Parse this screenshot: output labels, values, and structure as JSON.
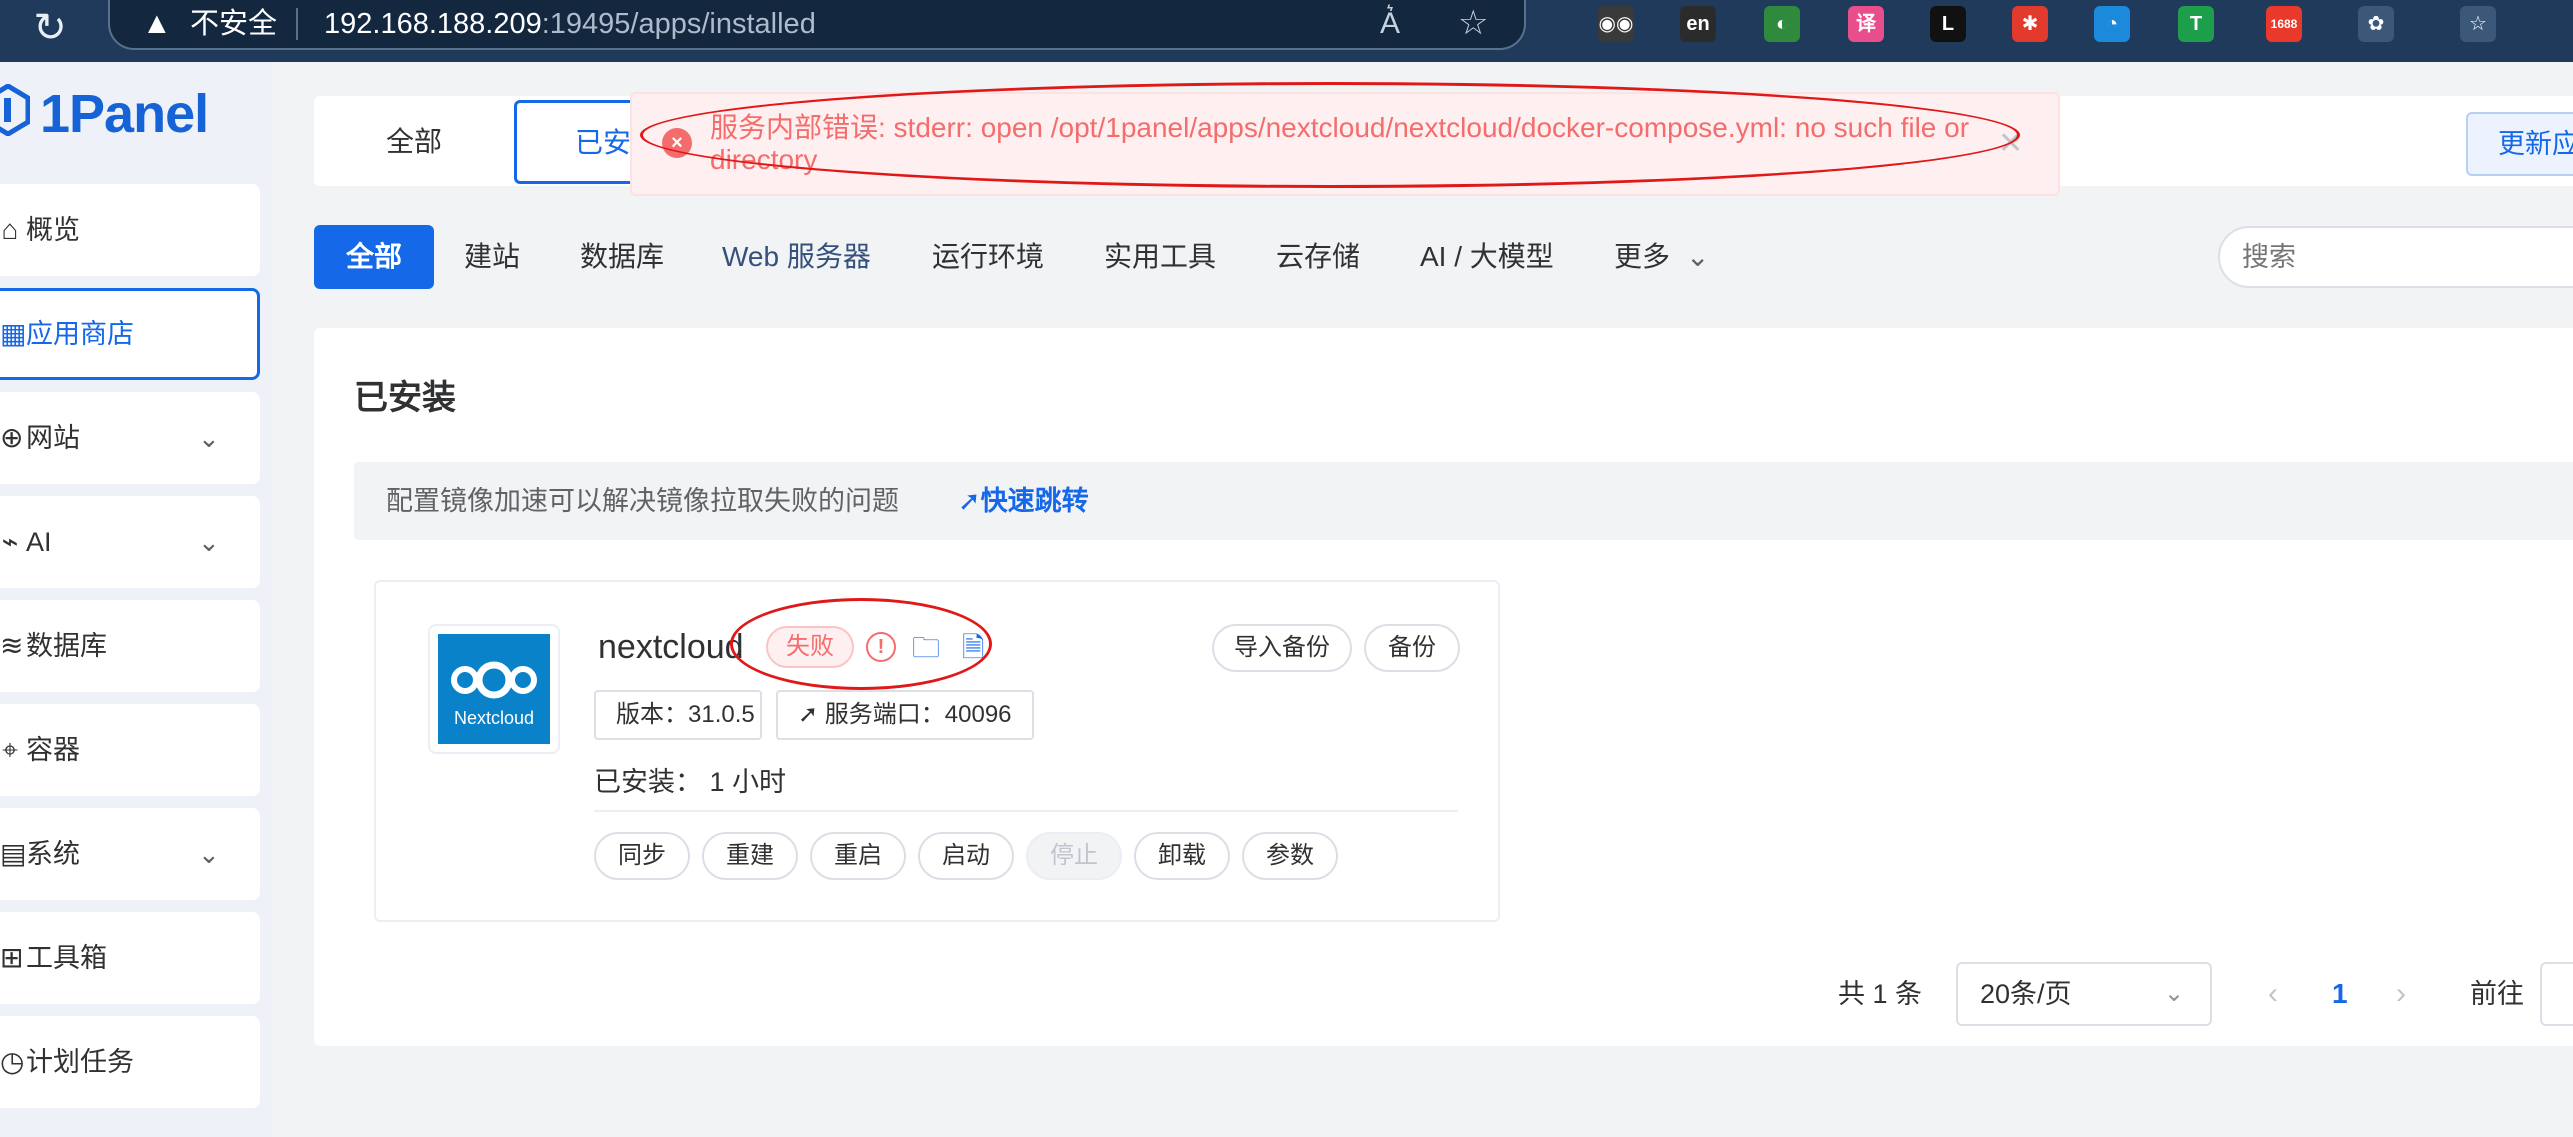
{
  "browser": {
    "security_label": "不安全",
    "url_host": "192.168.188.209",
    "url_rest": ":19495/apps/installed",
    "extensions": [
      {
        "icon": "owl-icon",
        "text": "◉◉",
        "color": "#3a3a3a"
      },
      {
        "icon": "en-dict-icon",
        "text": "en",
        "color": "#2b2b2b"
      },
      {
        "icon": "globe-download-icon",
        "text": "◐",
        "color": "#2f8a3e"
      },
      {
        "icon": "translate-icon",
        "text": "译",
        "color": "#e94e8c"
      },
      {
        "icon": "l-icon",
        "text": "L",
        "color": "#111111"
      },
      {
        "icon": "pinwheel-icon",
        "text": "✱",
        "color": "#e23b2e"
      },
      {
        "icon": "circle-color-icon",
        "text": "◔",
        "color": "#1c8adb"
      },
      {
        "icon": "t-icon",
        "text": "T",
        "color": "#1c9e4a"
      },
      {
        "icon": "1688-icon",
        "text": "1688",
        "color": "#e8392b"
      },
      {
        "icon": "puzzle-icon",
        "text": "✿",
        "color": "#3b5779"
      },
      {
        "icon": "favorites-icon",
        "text": "☆",
        "color": "#3b5779"
      }
    ]
  },
  "sidebar": {
    "logo": "1Panel",
    "items": [
      {
        "label": "概览",
        "icon": "home-icon",
        "glyph": "⌂",
        "chevron": false,
        "active": false
      },
      {
        "label": "应用商店",
        "icon": "appstore-icon",
        "glyph": "▦",
        "chevron": false,
        "active": true
      },
      {
        "label": "网站",
        "icon": "globe-icon",
        "glyph": "⊕",
        "chevron": true,
        "active": false
      },
      {
        "label": "AI",
        "icon": "ai-icon",
        "glyph": "⌁",
        "chevron": true,
        "active": false
      },
      {
        "label": "数据库",
        "icon": "database-icon",
        "glyph": "≋",
        "chevron": false,
        "active": false
      },
      {
        "label": "容器",
        "icon": "container-icon",
        "glyph": "⌖",
        "chevron": false,
        "active": false
      },
      {
        "label": "系统",
        "icon": "system-icon",
        "glyph": "▤",
        "chevron": true,
        "active": false
      },
      {
        "label": "工具箱",
        "icon": "toolbox-icon",
        "glyph": "⊞",
        "chevron": false,
        "active": false
      },
      {
        "label": "计划任务",
        "icon": "schedule-icon",
        "glyph": "◷",
        "chevron": false,
        "active": false
      }
    ]
  },
  "tabs": {
    "all": "全部",
    "installed": "已安",
    "update": "更新应"
  },
  "toast": {
    "message": "服务内部错误: stderr: open /opt/1panel/apps/nextcloud/nextcloud/docker-compose.yml: no such file or directory"
  },
  "categories": [
    "全部",
    "建站",
    "数据库",
    "Web 服务器",
    "运行环境",
    "实用工具",
    "云存储",
    "AI / 大模型",
    "更多"
  ],
  "search": {
    "placeholder": "搜索"
  },
  "installed": {
    "title": "已安装",
    "mirror_hint": "配置镜像加速可以解决镜像拉取失败的问题",
    "mirror_link": "快速跳转"
  },
  "app": {
    "name": "nextcloud",
    "logo_text": "Nextcloud",
    "status": "失败",
    "version": "版本：31.0.5",
    "port": "服务端口：40096",
    "installed_time": "已安装： 1 小时",
    "top_actions": [
      "导入备份",
      "备份"
    ],
    "actions": [
      {
        "label": "同步",
        "disabled": false
      },
      {
        "label": "重建",
        "disabled": false
      },
      {
        "label": "重启",
        "disabled": false
      },
      {
        "label": "启动",
        "disabled": false
      },
      {
        "label": "停止",
        "disabled": true
      },
      {
        "label": "卸载",
        "disabled": false
      },
      {
        "label": "参数",
        "disabled": false
      }
    ]
  },
  "pagination": {
    "total": "共 1 条",
    "page_size": "20条/页",
    "current_page": "1",
    "goto_label": "前往"
  }
}
